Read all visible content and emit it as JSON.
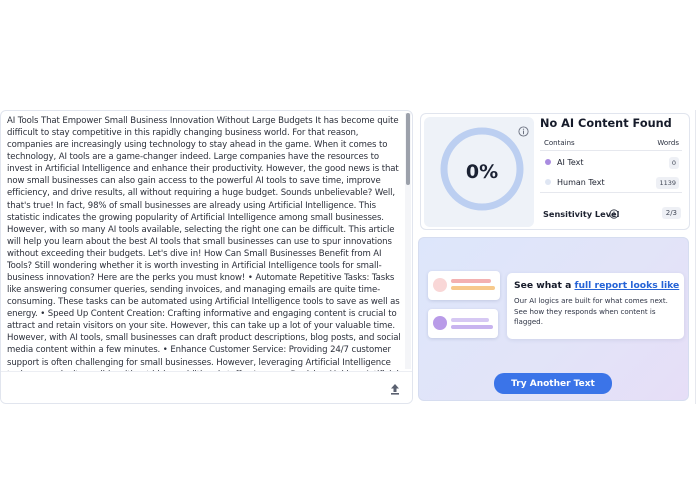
{
  "editor": {
    "text": "AI Tools That Empower Small Business Innovation Without Large Budgets It has become quite difficult to stay competitive in this rapidly changing business world. For that reason, companies are increasingly using technology to stay ahead in the game. When it comes to technology, AI tools are a game-changer indeed. Large companies have the resources to invest in Artificial Intelligence and enhance their productivity. However, the good news is that now small businesses can also gain access to the powerful AI tools to save time, improve efficiency, and drive results, all without requiring a huge budget. Sounds unbelievable? Well, that's true! In fact, 98% of small businesses are already using Artificial Intelligence. This statistic indicates the growing popularity of Artificial Intelligence among small businesses. However, with so many AI tools available, selecting the right one can be difficult. This article will help you learn about the best AI tools that small businesses can use to spur innovations without exceeding their budgets. Let's dive in! How Can Small Businesses Benefit from AI Tools? Still wondering whether it is worth investing in Artificial Intelligence tools for small-business innovation? Here are the perks you must know! • Automate Repetitive Tasks: Tasks like answering consumer queries, sending invoices, and managing emails are quite time-consuming. These tasks can be automated using Artificial Intelligence tools to save as well as energy. • Speed Up Content Creation: Crafting informative and engaging content is crucial to attract and retain visitors on your site. However, this can take up a lot of your valuable time. However, with AI tools, small businesses can draft product descriptions, blog posts, and social media content within a few minutes. • Enhance Customer Service: Providing 24/7 customer support is often challenging for small businesses. However, leveraging Artificial Intelligence tools can make it possible without hiring additional staff. • Improve Decision-Making: Artificial Intelligence tools can analyze a very large amount of",
    "upload_icon": "upload-arrow-icon"
  },
  "result": {
    "percentage": "0%",
    "ai_fraction": 0,
    "title": "No AI Content Found",
    "contains_header": "Contains",
    "words_header": "Words",
    "rows": [
      {
        "label": "AI Text",
        "count": "0",
        "dot_color": "#a98be0"
      },
      {
        "label": "Human Text",
        "count": "1139",
        "dot_color": "#dfe6f3"
      }
    ],
    "sensitivity_label": "Sensitivity Level",
    "sensitivity_value": "2/3",
    "gauge_color": "#b9cdf0"
  },
  "promo": {
    "title_prefix": "See what a ",
    "title_link": "full report looks like",
    "description": "Our AI logics are built for what comes next. See how they responds when content is flagged.",
    "button": "Try Another Text",
    "accent": "#3b74e8"
  }
}
